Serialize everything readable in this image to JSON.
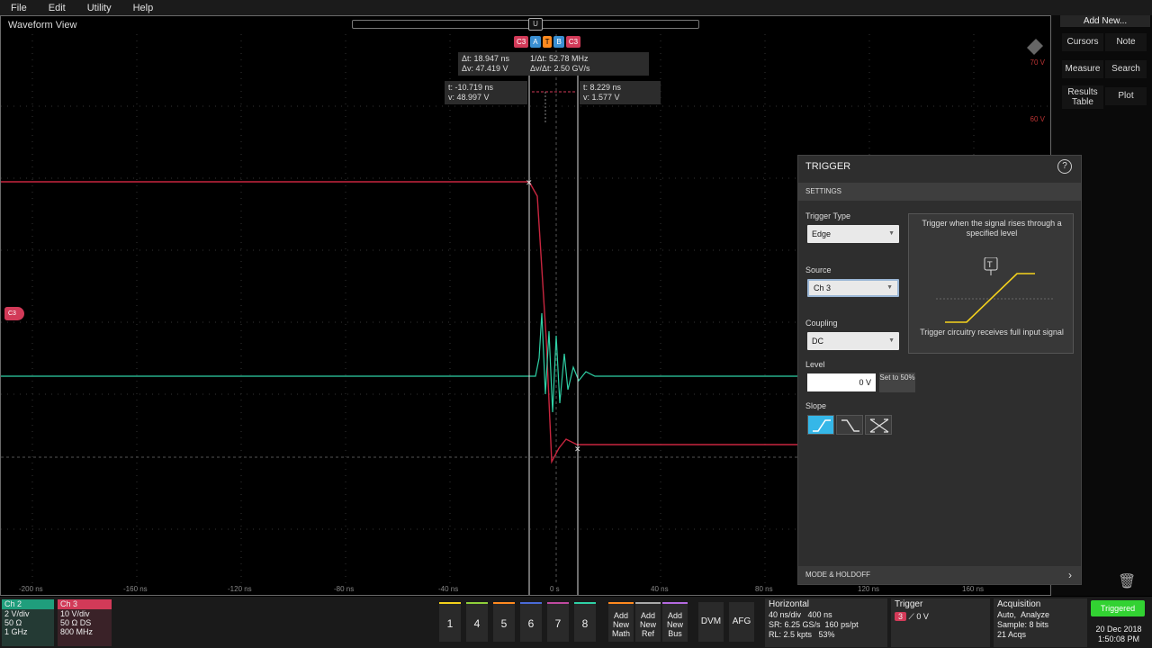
{
  "menu": [
    "File",
    "Edit",
    "Utility",
    "Help"
  ],
  "waveform_view": {
    "title": "Waveform View",
    "scroll_thumb": "U",
    "cursor_tags": [
      "C3",
      "A",
      "T",
      "B",
      "C3"
    ],
    "readout_delta": {
      "dt": "Δt: 18.947 ns",
      "dv": "Δv: 47.419 V",
      "inv": "1/Δt: 52.78 MHz",
      "slew": "Δv/Δt: 2.50 GV/s"
    },
    "readout_a": {
      "t": "t: -10.719 ns",
      "v": "v: 48.997 V"
    },
    "readout_b": {
      "t": "t: 8.229 ns",
      "v": "v: 1.577 V"
    },
    "right_scale": [
      "70 V",
      "60 V"
    ],
    "time_ticks": [
      "-200 ns",
      "-160 ns",
      "-120 ns",
      "-80 ns",
      "-40 ns",
      "0 s",
      "40 ns",
      "80 ns",
      "120 ns",
      "160 ns"
    ],
    "ch3_marker": "C3"
  },
  "sidebar": {
    "add_new": "Add New...",
    "buttons": [
      "Cursors",
      "Note",
      "Measure",
      "Search",
      "Results Table",
      "Plot"
    ]
  },
  "trigger_dialog": {
    "title": "TRIGGER",
    "help": "?",
    "settings": "SETTINGS",
    "trigger_type_label": "Trigger Type",
    "trigger_type": "Edge",
    "source_label": "Source",
    "source": "Ch 3",
    "coupling_label": "Coupling",
    "coupling": "DC",
    "level_label": "Level",
    "level": "0 V",
    "set50": "Set to 50%",
    "slope_label": "Slope",
    "info_top": "Trigger when the signal rises through a specified level",
    "info_icon": "T",
    "info_bottom": "Trigger circuitry receives full input signal",
    "mode_holdoff": "MODE & HOLDOFF"
  },
  "bottom": {
    "ch2": {
      "name": "Ch 2",
      "l1": "2 V/div",
      "l2": "50 Ω",
      "l3": "1 GHz"
    },
    "ch3": {
      "name": "Ch 3",
      "l1": "10 V/div",
      "l2": "50 Ω   DS",
      "l3": "800 MHz"
    },
    "channel_buttons": [
      "1",
      "4",
      "5",
      "6",
      "7",
      "8"
    ],
    "add_math": "Add New Math",
    "add_ref": "Add New Ref",
    "add_bus": "Add New Bus",
    "dvm": "DVM",
    "afg": "AFG",
    "horizontal": {
      "title": "Horizontal",
      "l1a": "40 ns/div",
      "l1b": "400 ns",
      "l2a": "SR: 6.25 GS/s",
      "l2b": "160 ps/pt",
      "l3a": "RL: 2.5 kpts",
      "l3b": "53%"
    },
    "trigger": {
      "title": "Trigger",
      "ch": "3",
      "level": "0 V"
    },
    "acquisition": {
      "title": "Acquisition",
      "l1a": "Auto,",
      "l1b": "Analyze",
      "l2": "Sample: 8 bits",
      "l3": "21 Acqs"
    },
    "status": "Triggered",
    "date": "20 Dec 2018",
    "time": "1:50:08 PM"
  },
  "colors": {
    "ch3": "#d23a58",
    "ch2": "#2fd1a6",
    "accent": "#35b7e8",
    "triggered": "#32d232"
  }
}
